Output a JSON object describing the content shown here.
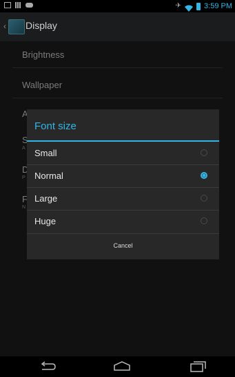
{
  "status_bar": {
    "time": "3:59 PM",
    "left_icons": [
      "image-notification-icon",
      "grid-notification-icon",
      "gamepad-notification-icon"
    ],
    "right_icons": [
      "running-icon",
      "wifi-icon",
      "battery-icon"
    ],
    "accent": "#33b5e5"
  },
  "action_bar": {
    "title": "Display",
    "app_icon": "display-settings-icon"
  },
  "settings_list": {
    "items": [
      {
        "label": "Brightness"
      },
      {
        "label": "Wallpaper"
      },
      {
        "label": "A"
      },
      {
        "label": "S",
        "sub": "A"
      },
      {
        "label": "D",
        "sub": "P"
      },
      {
        "label": "F",
        "sub": "N"
      }
    ]
  },
  "dialog": {
    "title": "Font size",
    "options": [
      {
        "label": "Small",
        "selected": false
      },
      {
        "label": "Normal",
        "selected": true
      },
      {
        "label": "Large",
        "selected": false
      },
      {
        "label": "Huge",
        "selected": false
      }
    ],
    "cancel_label": "Cancel",
    "accent": "#33b5e5"
  },
  "nav_bar": {
    "icons": [
      "back-icon",
      "home-icon",
      "recent-apps-icon"
    ]
  }
}
